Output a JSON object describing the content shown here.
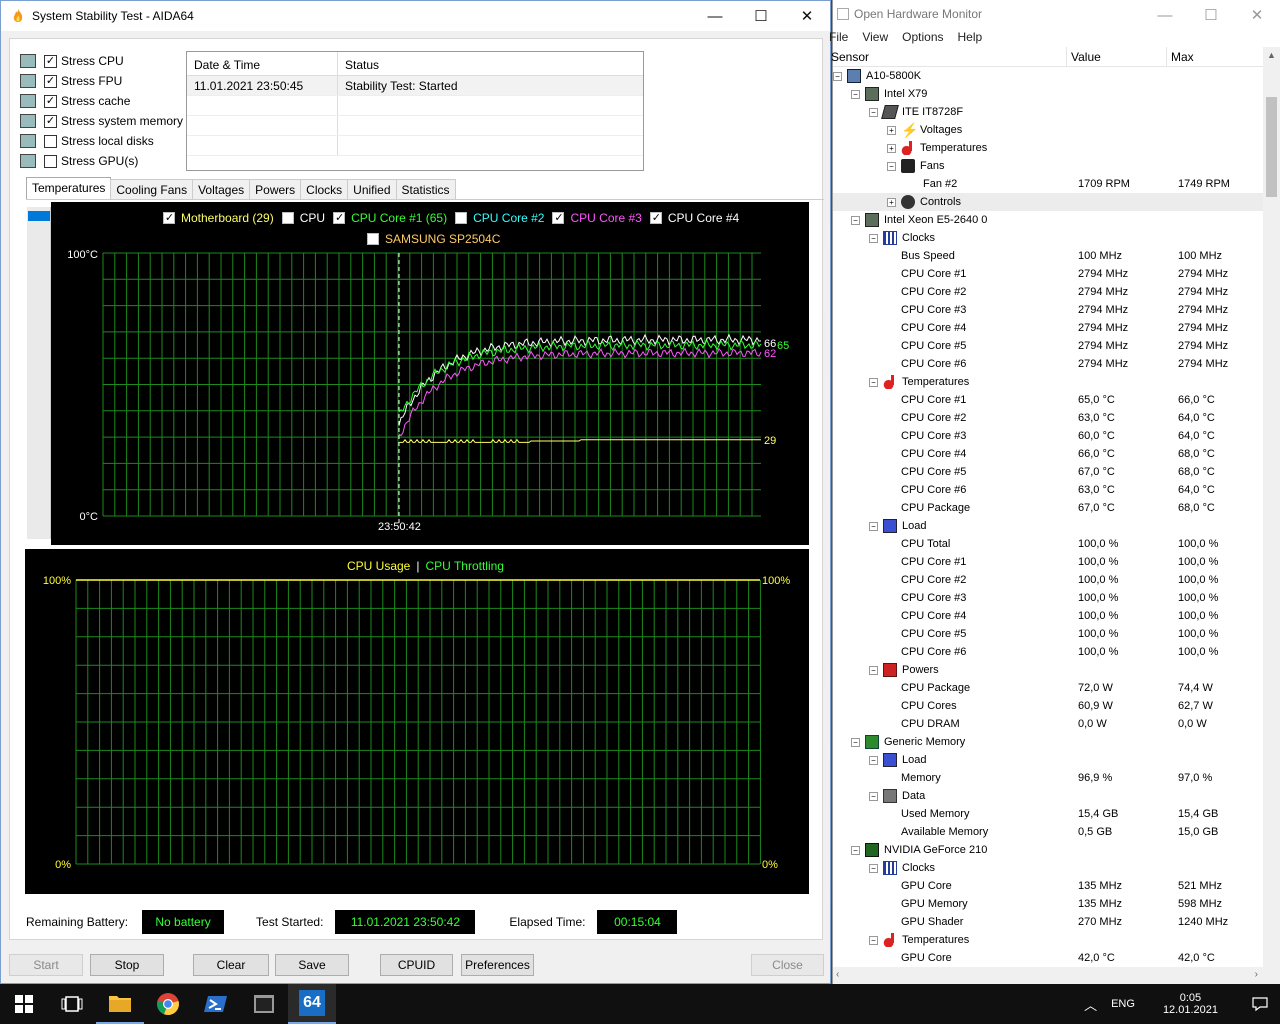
{
  "aida": {
    "title": "System Stability Test - AIDA64",
    "stress_items": [
      {
        "label": "Stress CPU",
        "checked": true,
        "icon": "cpu-chip-icon"
      },
      {
        "label": "Stress FPU",
        "checked": true,
        "icon": "fpu-chip-icon"
      },
      {
        "label": "Stress cache",
        "checked": true,
        "icon": "cache-chip-icon"
      },
      {
        "label": "Stress system memory",
        "checked": true,
        "icon": "memory-module-icon"
      },
      {
        "label": "Stress local disks",
        "checked": false,
        "icon": "disk-drive-icon"
      },
      {
        "label": "Stress GPU(s)",
        "checked": false,
        "icon": "monitor-icon"
      }
    ],
    "log": {
      "headers": [
        "Date & Time",
        "Status"
      ],
      "rows": [
        [
          "11.01.2021 23:50:45",
          "Stability Test: Started"
        ]
      ]
    },
    "tabs": [
      "Temperatures",
      "Cooling Fans",
      "Voltages",
      "Powers",
      "Clocks",
      "Unified",
      "Statistics"
    ],
    "temp_graph": {
      "legend": [
        {
          "label": "Motherboard (29)",
          "checked": true,
          "color": "#ffff66"
        },
        {
          "label": "CPU",
          "checked": false,
          "color": "#ffffff"
        },
        {
          "label": "CPU Core #1 (65)",
          "checked": true,
          "color": "#33ff33"
        },
        {
          "label": "CPU Core #2",
          "checked": false,
          "color": "#33ffff"
        },
        {
          "label": "CPU Core #3",
          "checked": true,
          "color": "#ff55ff"
        },
        {
          "label": "CPU Core #4",
          "checked": true,
          "color": "#ffffff"
        }
      ],
      "legend2": {
        "label": "SAMSUNG SP2504C",
        "checked": false,
        "color": "#ffcc66"
      },
      "y_max_label": "100°C",
      "y_min_label": "0°C",
      "x_label": "23:50:42",
      "end_labels": {
        "core4": "66",
        "core1": "65",
        "core3": "62",
        "motherboard": "29"
      }
    },
    "usage_graph": {
      "title_left": "CPU Usage",
      "separator": "|",
      "title_right": "CPU Throttling",
      "left_max": "100%",
      "left_min": "0%",
      "right_max": "100%",
      "right_min": "0%"
    },
    "status": {
      "battery_label": "Remaining Battery:",
      "battery_value": "No battery",
      "started_label": "Test Started:",
      "started_value": "11.01.2021 23:50:42",
      "elapsed_label": "Elapsed Time:",
      "elapsed_value": "00:15:04"
    },
    "buttons": {
      "start": "Start",
      "stop": "Stop",
      "clear": "Clear",
      "save": "Save",
      "cpuid": "CPUID",
      "preferences": "Preferences",
      "close": "Close"
    }
  },
  "ohm": {
    "title": "Open Hardware Monitor",
    "menu": [
      "File",
      "View",
      "Options",
      "Help"
    ],
    "columns": [
      "Sensor",
      "Value",
      "Max"
    ],
    "rows": [
      {
        "lvl": 0,
        "exp": "−",
        "icon": "pc",
        "name": "A10-5800K",
        "v": "",
        "m": ""
      },
      {
        "lvl": 1,
        "exp": "−",
        "icon": "hw",
        "name": "Intel X79",
        "v": "",
        "m": ""
      },
      {
        "lvl": 2,
        "exp": "−",
        "icon": "chip",
        "name": "ITE IT8728F",
        "v": "",
        "m": ""
      },
      {
        "lvl": 3,
        "exp": "+",
        "icon": "volt",
        "name": "Voltages",
        "v": "",
        "m": ""
      },
      {
        "lvl": 3,
        "exp": "+",
        "icon": "temp",
        "name": "Temperatures",
        "v": "",
        "m": ""
      },
      {
        "lvl": 3,
        "exp": "−",
        "icon": "fan",
        "name": "Fans",
        "v": "",
        "m": ""
      },
      {
        "lvl": 4,
        "exp": "",
        "icon": "",
        "name": "Fan #2",
        "v": "1709 RPM",
        "m": "1749 RPM"
      },
      {
        "lvl": 3,
        "exp": "+",
        "icon": "ctl",
        "name": "Controls",
        "v": "",
        "m": "",
        "sel": true
      },
      {
        "lvl": 1,
        "exp": "−",
        "icon": "hw",
        "name": "Intel Xeon E5-2640 0",
        "v": "",
        "m": ""
      },
      {
        "lvl": 2,
        "exp": "−",
        "icon": "clk",
        "name": "Clocks",
        "v": "",
        "m": ""
      },
      {
        "lvl": 3,
        "exp": "",
        "icon": "",
        "name": "Bus Speed",
        "v": "100 MHz",
        "m": "100 MHz"
      },
      {
        "lvl": 3,
        "exp": "",
        "icon": "",
        "name": "CPU Core #1",
        "v": "2794 MHz",
        "m": "2794 MHz"
      },
      {
        "lvl": 3,
        "exp": "",
        "icon": "",
        "name": "CPU Core #2",
        "v": "2794 MHz",
        "m": "2794 MHz"
      },
      {
        "lvl": 3,
        "exp": "",
        "icon": "",
        "name": "CPU Core #3",
        "v": "2794 MHz",
        "m": "2794 MHz"
      },
      {
        "lvl": 3,
        "exp": "",
        "icon": "",
        "name": "CPU Core #4",
        "v": "2794 MHz",
        "m": "2794 MHz"
      },
      {
        "lvl": 3,
        "exp": "",
        "icon": "",
        "name": "CPU Core #5",
        "v": "2794 MHz",
        "m": "2794 MHz"
      },
      {
        "lvl": 3,
        "exp": "",
        "icon": "",
        "name": "CPU Core #6",
        "v": "2794 MHz",
        "m": "2794 MHz"
      },
      {
        "lvl": 2,
        "exp": "−",
        "icon": "temp",
        "name": "Temperatures",
        "v": "",
        "m": ""
      },
      {
        "lvl": 3,
        "exp": "",
        "icon": "",
        "name": "CPU Core #1",
        "v": "65,0 °C",
        "m": "66,0 °C"
      },
      {
        "lvl": 3,
        "exp": "",
        "icon": "",
        "name": "CPU Core #2",
        "v": "63,0 °C",
        "m": "64,0 °C"
      },
      {
        "lvl": 3,
        "exp": "",
        "icon": "",
        "name": "CPU Core #3",
        "v": "60,0 °C",
        "m": "64,0 °C"
      },
      {
        "lvl": 3,
        "exp": "",
        "icon": "",
        "name": "CPU Core #4",
        "v": "66,0 °C",
        "m": "68,0 °C"
      },
      {
        "lvl": 3,
        "exp": "",
        "icon": "",
        "name": "CPU Core #5",
        "v": "67,0 °C",
        "m": "68,0 °C"
      },
      {
        "lvl": 3,
        "exp": "",
        "icon": "",
        "name": "CPU Core #6",
        "v": "63,0 °C",
        "m": "64,0 °C"
      },
      {
        "lvl": 3,
        "exp": "",
        "icon": "",
        "name": "CPU Package",
        "v": "67,0 °C",
        "m": "68,0 °C"
      },
      {
        "lvl": 2,
        "exp": "−",
        "icon": "load",
        "name": "Load",
        "v": "",
        "m": ""
      },
      {
        "lvl": 3,
        "exp": "",
        "icon": "",
        "name": "CPU Total",
        "v": "100,0 %",
        "m": "100,0 %"
      },
      {
        "lvl": 3,
        "exp": "",
        "icon": "",
        "name": "CPU Core #1",
        "v": "100,0 %",
        "m": "100,0 %"
      },
      {
        "lvl": 3,
        "exp": "",
        "icon": "",
        "name": "CPU Core #2",
        "v": "100,0 %",
        "m": "100,0 %"
      },
      {
        "lvl": 3,
        "exp": "",
        "icon": "",
        "name": "CPU Core #3",
        "v": "100,0 %",
        "m": "100,0 %"
      },
      {
        "lvl": 3,
        "exp": "",
        "icon": "",
        "name": "CPU Core #4",
        "v": "100,0 %",
        "m": "100,0 %"
      },
      {
        "lvl": 3,
        "exp": "",
        "icon": "",
        "name": "CPU Core #5",
        "v": "100,0 %",
        "m": "100,0 %"
      },
      {
        "lvl": 3,
        "exp": "",
        "icon": "",
        "name": "CPU Core #6",
        "v": "100,0 %",
        "m": "100,0 %"
      },
      {
        "lvl": 2,
        "exp": "−",
        "icon": "pow",
        "name": "Powers",
        "v": "",
        "m": ""
      },
      {
        "lvl": 3,
        "exp": "",
        "icon": "",
        "name": "CPU Package",
        "v": "72,0 W",
        "m": "74,4 W"
      },
      {
        "lvl": 3,
        "exp": "",
        "icon": "",
        "name": "CPU Cores",
        "v": "60,9 W",
        "m": "62,7 W"
      },
      {
        "lvl": 3,
        "exp": "",
        "icon": "",
        "name": "CPU DRAM",
        "v": "0,0 W",
        "m": "0,0 W"
      },
      {
        "lvl": 1,
        "exp": "−",
        "icon": "mem",
        "name": "Generic Memory",
        "v": "",
        "m": ""
      },
      {
        "lvl": 2,
        "exp": "−",
        "icon": "load",
        "name": "Load",
        "v": "",
        "m": ""
      },
      {
        "lvl": 3,
        "exp": "",
        "icon": "",
        "name": "Memory",
        "v": "96,9 %",
        "m": "97,0 %"
      },
      {
        "lvl": 2,
        "exp": "−",
        "icon": "data",
        "name": "Data",
        "v": "",
        "m": ""
      },
      {
        "lvl": 3,
        "exp": "",
        "icon": "",
        "name": "Used Memory",
        "v": "15,4 GB",
        "m": "15,4 GB"
      },
      {
        "lvl": 3,
        "exp": "",
        "icon": "",
        "name": "Available Memory",
        "v": "0,5 GB",
        "m": "15,0 GB"
      },
      {
        "lvl": 1,
        "exp": "−",
        "icon": "gpu",
        "name": "NVIDIA GeForce 210",
        "v": "",
        "m": ""
      },
      {
        "lvl": 2,
        "exp": "−",
        "icon": "clk",
        "name": "Clocks",
        "v": "",
        "m": ""
      },
      {
        "lvl": 3,
        "exp": "",
        "icon": "",
        "name": "GPU Core",
        "v": "135 MHz",
        "m": "521 MHz"
      },
      {
        "lvl": 3,
        "exp": "",
        "icon": "",
        "name": "GPU Memory",
        "v": "135 MHz",
        "m": "598 MHz"
      },
      {
        "lvl": 3,
        "exp": "",
        "icon": "",
        "name": "GPU Shader",
        "v": "270 MHz",
        "m": "1240 MHz"
      },
      {
        "lvl": 2,
        "exp": "−",
        "icon": "temp",
        "name": "Temperatures",
        "v": "",
        "m": ""
      },
      {
        "lvl": 3,
        "exp": "",
        "icon": "",
        "name": "GPU Core",
        "v": "42,0 °C",
        "m": "42,0 °C"
      }
    ]
  },
  "taskbar": {
    "items": [
      "start-windows-icon",
      "task-view-icon",
      "file-explorer-icon",
      "chrome-icon",
      "powershell-icon",
      "terminal-window-icon",
      "aida64-icon"
    ],
    "aida_label": "64",
    "lang": "ENG",
    "time": "0:05",
    "date": "12.01.2021"
  }
}
